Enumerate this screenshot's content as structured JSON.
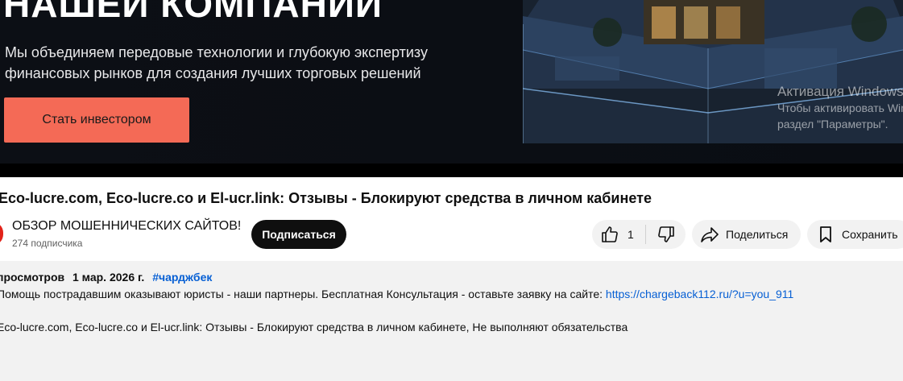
{
  "banner": {
    "headline": "НАШЕЙ КОМПАНИИ",
    "text_line1": "Мы объединяем передовые технологии и глубокую экспертизу",
    "text_line2": "финансовых рынков для создания лучших торговых решений",
    "cta_label": "Стать инвестором"
  },
  "windows_watermark": {
    "line1": "Активация Windows",
    "line2": "Чтобы активировать Windows, перейдите в",
    "line3": "раздел \"Параметры\"."
  },
  "video": {
    "title": "Eco-lucre.com, Eco-lucre.co и El-ucr.link: Отзывы - Блокируют средства в личном кабинете"
  },
  "channel": {
    "name": "ОБЗОР МОШЕННИЧЕСКИХ САЙТОВ!",
    "subscribers": "274 подписчика",
    "subscribe_label": "Подписаться"
  },
  "actions": {
    "like_count": "1",
    "share_label": "Поделиться",
    "save_label": "Сохранить"
  },
  "description": {
    "views": "просмотров",
    "date": "1 мар. 2026 г.",
    "hashtag": "#чарджбек",
    "line1_text": "Помощь пострадавшим оказывают юристы - наши партнеры. Бесплатная Консультация - оставьте заявку на сайте: ",
    "line1_link": "https://chargeback112.ru/?u=you_911",
    "line2_text": "Eco-lucre.com, Eco-lucre.co и El-ucr.link: Отзывы - Блокируют средства в личном кабинете, Не выполняют обязательства"
  },
  "colors": {
    "cta": "#f46a56",
    "link": "#065fd4",
    "subscribe_bg": "#0f0f0f",
    "pill_bg": "#f2f2f2",
    "avatar": "#e2231a"
  },
  "icons": [
    "like-icon",
    "dislike-icon",
    "share-icon",
    "save-icon"
  ]
}
